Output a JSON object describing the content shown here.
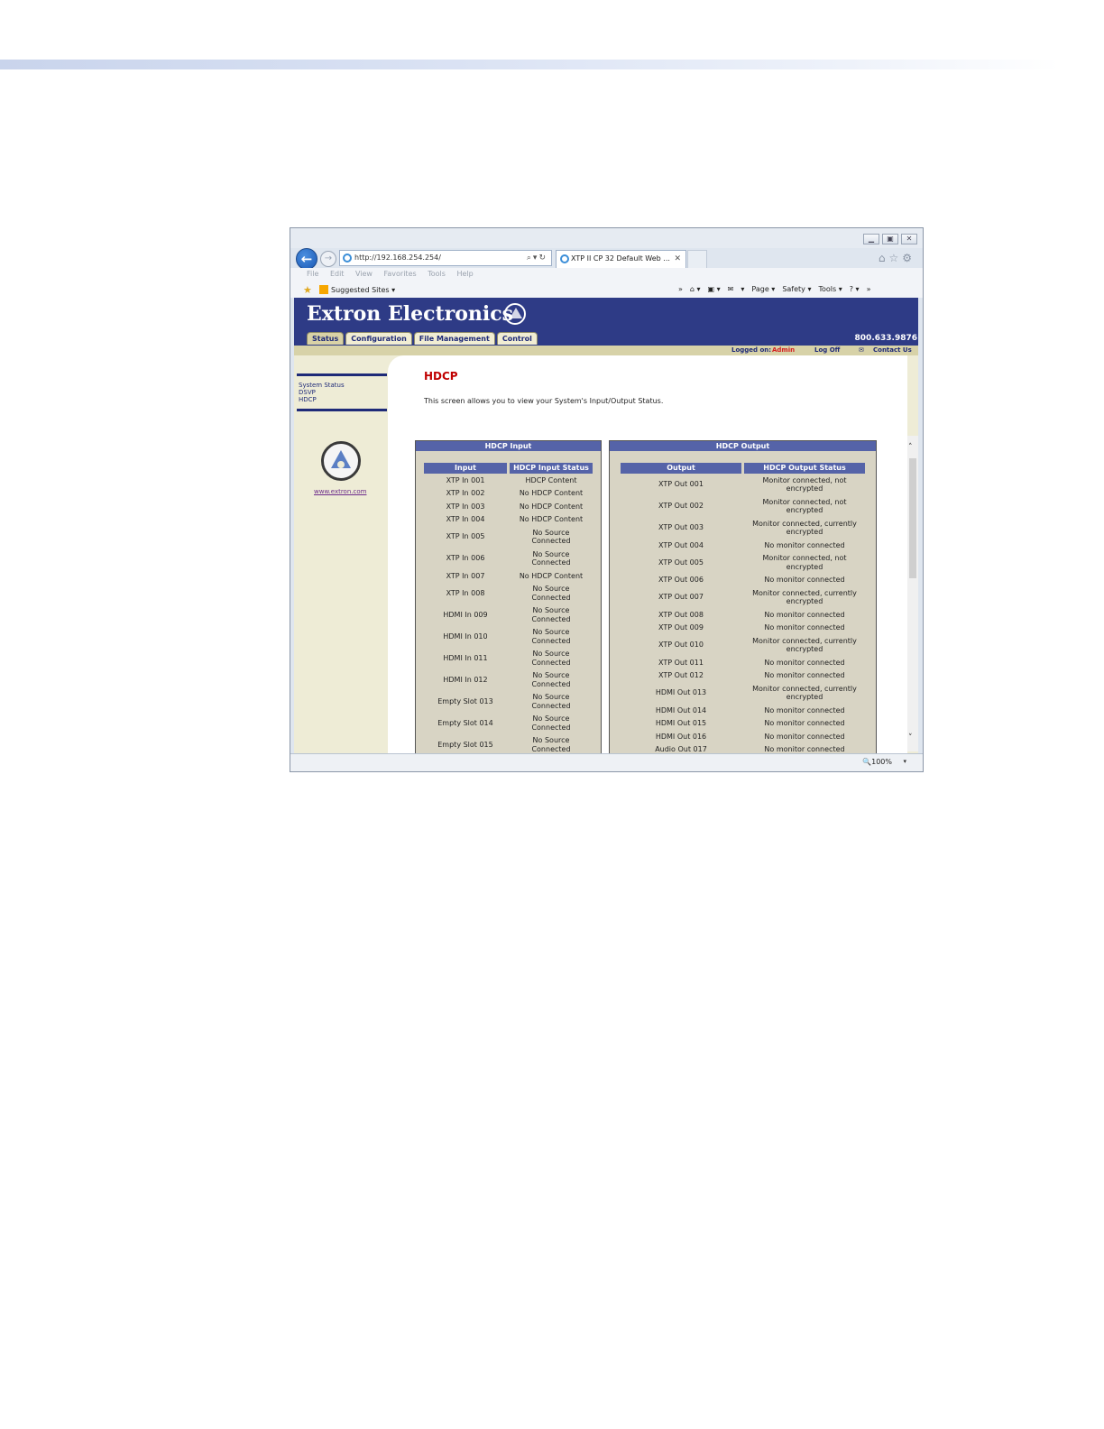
{
  "browser": {
    "url": "http://192.168.254.254/",
    "tab_title": "XTP II CP 32 Default Web ...",
    "menu": [
      "File",
      "Edit",
      "View",
      "Favorites",
      "Tools",
      "Help"
    ],
    "favorites_label": "Suggested Sites ▾",
    "toolbar": [
      "»",
      "⌂ ▾",
      "▣ ▾",
      "✉",
      "▾",
      "Page ▾",
      "Safety ▾",
      "Tools ▾",
      "? ▾",
      "»"
    ],
    "zoom": "100%"
  },
  "site": {
    "logo": "Extron Electronics",
    "phone": "800.633.9876",
    "tabs": [
      "Status",
      "Configuration",
      "File Management",
      "Control"
    ],
    "logged_on_label": "Logged on:",
    "logged_on_user": "Admin",
    "log_off": "Log Off",
    "contact_us": "Contact Us",
    "side_menu": [
      "System Status",
      "DSVP",
      "HDCP"
    ],
    "side_link": "www.extron.com"
  },
  "page": {
    "heading": "HDCP",
    "intro": "This screen allows you to view your System's Input/Output Status."
  },
  "hdcp_input": {
    "title": "HDCP Input",
    "headers": [
      "Input",
      "HDCP Input Status"
    ],
    "rows": [
      [
        "XTP In 001",
        "HDCP Content"
      ],
      [
        "XTP In 002",
        "No HDCP Content"
      ],
      [
        "XTP In 003",
        "No HDCP Content"
      ],
      [
        "XTP In 004",
        "No HDCP Content"
      ],
      [
        "XTP In 005",
        "No Source\nConnected"
      ],
      [
        "XTP In 006",
        "No Source\nConnected"
      ],
      [
        "XTP In 007",
        "No HDCP Content"
      ],
      [
        "XTP In 008",
        "No Source\nConnected"
      ],
      [
        "HDMI In 009",
        "No Source\nConnected"
      ],
      [
        "HDMI In 010",
        "No Source\nConnected"
      ],
      [
        "HDMI In 011",
        "No Source\nConnected"
      ],
      [
        "HDMI In 012",
        "No Source\nConnected"
      ],
      [
        "Empty Slot 013",
        "No Source\nConnected"
      ],
      [
        "Empty Slot 014",
        "No Source\nConnected"
      ],
      [
        "Empty Slot 015",
        "No Source\nConnected"
      ]
    ]
  },
  "hdcp_output": {
    "title": "HDCP Output",
    "headers": [
      "Output",
      "HDCP Output Status"
    ],
    "rows": [
      [
        "XTP Out 001",
        "Monitor connected, not\nencrypted"
      ],
      [
        "XTP Out 002",
        "Monitor connected, not\nencrypted"
      ],
      [
        "XTP Out 003",
        "Monitor connected, currently\nencrypted"
      ],
      [
        "XTP Out 004",
        "No monitor connected"
      ],
      [
        "XTP Out 005",
        "Monitor connected, not\nencrypted"
      ],
      [
        "XTP Out 006",
        "No monitor connected"
      ],
      [
        "XTP Out 007",
        "Monitor connected, currently\nencrypted"
      ],
      [
        "XTP Out 008",
        "No monitor connected"
      ],
      [
        "XTP Out 009",
        "No monitor connected"
      ],
      [
        "XTP Out 010",
        "Monitor connected, currently\nencrypted"
      ],
      [
        "XTP Out 011",
        "No monitor connected"
      ],
      [
        "XTP Out 012",
        "No monitor connected"
      ],
      [
        "HDMI Out 013",
        "Monitor connected, currently\nencrypted"
      ],
      [
        "HDMI Out 014",
        "No monitor connected"
      ],
      [
        "HDMI Out 015",
        "No monitor connected"
      ],
      [
        "HDMI Out 016",
        "No monitor connected"
      ],
      [
        "Audio Out 017",
        "No monitor connected"
      ]
    ]
  },
  "colors": {
    "banner": "#2e3b86",
    "heading": "#c00000",
    "table_header": "#5563a8",
    "panel_bg": "#d8d4c4",
    "sidebar_bg": "#eeecd6"
  }
}
